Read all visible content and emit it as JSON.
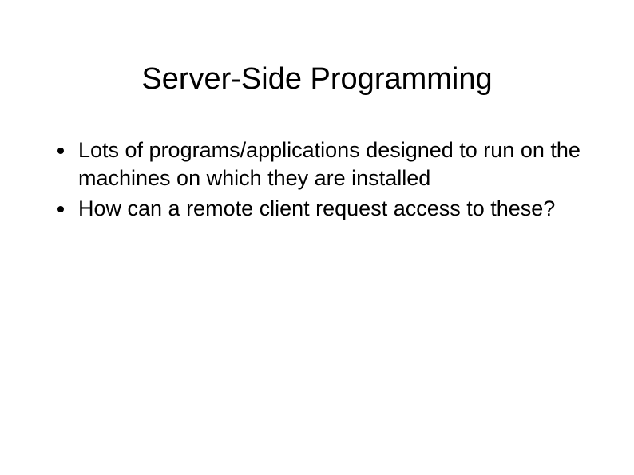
{
  "slide": {
    "title": "Server-Side Programming",
    "bullets": [
      "Lots of programs/applications designed to run on the machines on which they are installed",
      "How can a remote client request access to these?"
    ]
  }
}
